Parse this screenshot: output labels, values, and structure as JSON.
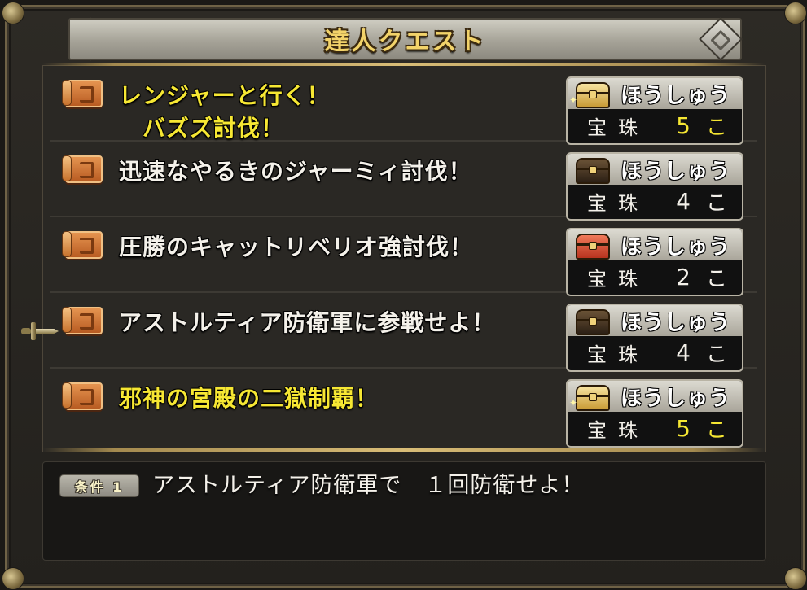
{
  "window": {
    "title": "達人クエスト"
  },
  "quests": [
    {
      "title": "レンジャーと行く！\n　バズズ討伐！",
      "highlighted": true,
      "reward_label": "ほうしゅう",
      "item": "宝珠",
      "count": "5",
      "unit": "こ",
      "count_highlighted": true,
      "chest_icon": "gold-chest-icon"
    },
    {
      "title": "迅速なやるきのジャーミィ討伐！",
      "highlighted": false,
      "reward_label": "ほうしゅう",
      "item": "宝珠",
      "count": "4",
      "unit": "こ",
      "count_highlighted": false,
      "chest_icon": "dark-chest-icon"
    },
    {
      "title": "圧勝のキャットリベリオ強討伐！",
      "highlighted": false,
      "reward_label": "ほうしゅう",
      "item": "宝珠",
      "count": "2",
      "unit": "こ",
      "count_highlighted": false,
      "chest_icon": "red-chest-icon"
    },
    {
      "title": "アストルティア防衛軍に参戦せよ！",
      "highlighted": false,
      "reward_label": "ほうしゅう",
      "item": "宝珠",
      "count": "4",
      "unit": "こ",
      "count_highlighted": false,
      "chest_icon": "dark-chest-icon"
    },
    {
      "title": "邪神の宮殿の二獄制覇！",
      "highlighted": true,
      "reward_label": "ほうしゅう",
      "item": "宝珠",
      "count": "5",
      "unit": "こ",
      "count_highlighted": true,
      "chest_icon": "gold-chest-icon"
    }
  ],
  "selected_index": 3,
  "condition": {
    "badge": "条件 1",
    "text": "アストルティア防衛軍で　１回防衛せよ！"
  },
  "colors": {
    "highlight": "#f6e733",
    "text": "#f4f1ea",
    "frame": "#6f6246"
  }
}
